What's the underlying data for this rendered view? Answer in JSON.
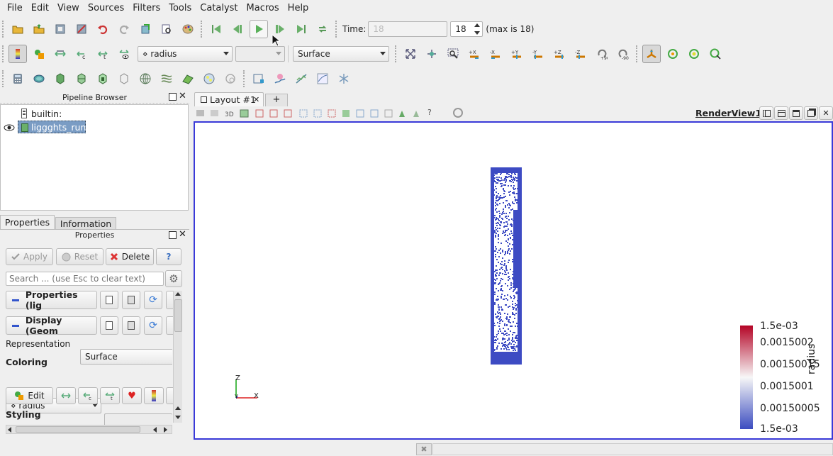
{
  "menu": [
    "File",
    "Edit",
    "View",
    "Sources",
    "Filters",
    "Tools",
    "Catalyst",
    "Macros",
    "Help"
  ],
  "time": {
    "label": "Time:",
    "value_disabled": "18",
    "value": "18",
    "max_text": "(max is 18)"
  },
  "color_combo": "⋄ radius",
  "comp_combo": "",
  "representation_combo": "Surface",
  "pipeline": {
    "title": "Pipeline Browser",
    "builtin": "builtin:",
    "item": "liggghts_run*"
  },
  "tabs": {
    "properties": "Properties",
    "information": "Information"
  },
  "properties": {
    "title": "Properties",
    "apply": "Apply",
    "reset": "Reset",
    "delete": "Delete",
    "help": "?",
    "search_placeholder": "Search ... (use Esc to clear text)",
    "section_properties": "Properties (lig",
    "section_display": "Display (Geom",
    "representation_label": "Representation",
    "representation_value": "Surface",
    "coloring_label": "Coloring",
    "coloring_value": "⋄ radius",
    "edit": "Edit",
    "styling_label": "Styling"
  },
  "layout_tab": "Layout #1",
  "add_tab": "+",
  "view_toolbar": {
    "label_3d": "3D",
    "name": "RenderView1",
    "unknown": "?"
  },
  "axes": {
    "z": "Z",
    "y": "Y",
    "x": "X"
  },
  "legend": {
    "title": "radius",
    "labels": [
      "1.5e-03",
      "0.0015002",
      "0.00150015",
      "0.0015001",
      "0.00150005",
      "1.5e-03"
    ],
    "colors": [
      "#b40426",
      "#f7f7f7",
      "#3b4cc0"
    ]
  },
  "particle_color": "#3d4bc3"
}
